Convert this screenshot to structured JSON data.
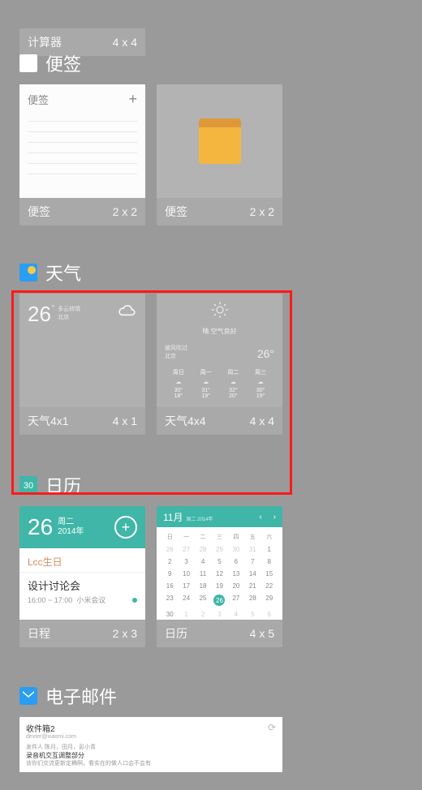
{
  "calculator": {
    "label": "计算器",
    "size": "4 x 4"
  },
  "notes": {
    "title": "便签",
    "items": [
      {
        "label": "便签",
        "size": "2 x 2",
        "head": "便签"
      },
      {
        "label": "便签",
        "size": "2 x 2"
      }
    ]
  },
  "weather": {
    "title": "天气",
    "items": [
      {
        "label": "天气4x1",
        "size": "4 x 1",
        "temp": "26",
        "sub": "多云转晴",
        "city": "北京"
      },
      {
        "label": "天气4x4",
        "size": "4 x 4",
        "cond": "晴  空气良好",
        "sub1": "被风吹过",
        "sub2": "北京",
        "temp": "26°",
        "days": [
          "周日",
          "周一",
          "周二",
          "周三"
        ],
        "hi": [
          "30°",
          "31°",
          "32°",
          "30°"
        ],
        "lo": [
          "18°",
          "19°",
          "20°",
          "19°"
        ]
      }
    ]
  },
  "calendar": {
    "title": "日历",
    "sched": {
      "label": "日程",
      "size": "2 x 3",
      "day": "26",
      "dow": "周二",
      "year": "2014年",
      "item1": "Lcc生日",
      "item2_title": "设计讨论会",
      "item2_time": "16:00 ~ 17:00",
      "item2_loc": "小米会议"
    },
    "cal": {
      "label": "日历",
      "size": "4 x 5",
      "month": "11月",
      "month_sub": "周二 2014年",
      "dow": [
        "日",
        "一",
        "二",
        "三",
        "四",
        "五",
        "六"
      ],
      "rows": [
        [
          "26",
          "27",
          "28",
          "29",
          "30",
          "31",
          "1"
        ],
        [
          "2",
          "3",
          "4",
          "5",
          "6",
          "7",
          "8"
        ],
        [
          "9",
          "10",
          "11",
          "12",
          "13",
          "14",
          "15"
        ],
        [
          "16",
          "17",
          "18",
          "19",
          "20",
          "21",
          "22"
        ],
        [
          "23",
          "24",
          "25",
          "26",
          "27",
          "28",
          "29"
        ],
        [
          "30",
          "1",
          "2",
          "3",
          "4",
          "5",
          "6"
        ]
      ],
      "today": "26"
    }
  },
  "email": {
    "title": "电子邮件",
    "inbox": "收件箱2",
    "addr": "dexter@xiaomi.com",
    "from": "发件人  陈月，田月，彭小青",
    "subj": "录音机交互调整部分",
    "body": "该你们交流更新定稿啊，看实在的做人口会不会有"
  }
}
